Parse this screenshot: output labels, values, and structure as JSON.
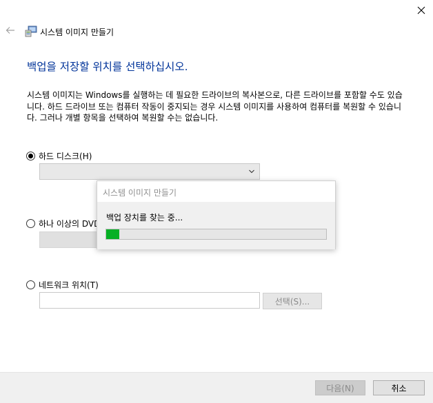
{
  "window": {
    "title": "시스템 이미지 만들기",
    "close_icon": "close-icon",
    "back_icon": "back-arrow-icon",
    "app_icon": "system-image-icon"
  },
  "main": {
    "instruction": "백업을 저장할 위치를 선택하십시오.",
    "description": "시스템 이미지는 Windows를 실행하는 데 필요한 드라이브의 복사본으로, 다른 드라이브를 포함할 수도 있습니다. 하드 드라이브 또는 컴퓨터 작동이 중지되는 경우 시스템 이미지를 사용하여 컴퓨터를 복원할 수 있습니다. 그러나 개별 항목을 선택하여 복원할 수는 없습니다."
  },
  "options": {
    "hard_disk": {
      "label": "하드 디스크(H)",
      "selected": true,
      "value": ""
    },
    "dvd": {
      "label": "하나 이상의 DVD",
      "selected": false,
      "value": ""
    },
    "network": {
      "label": "네트워크 위치(T)",
      "selected": false,
      "value": "",
      "select_button": "선택(S)..."
    }
  },
  "popup": {
    "title": "시스템 이미지 만들기",
    "message": "백업 장치를 찾는 중...",
    "progress": 0.06,
    "progress_color": "#06b025"
  },
  "footer": {
    "next_label": "다음(N)",
    "cancel_label": "취소"
  },
  "colors": {
    "instruction": "#003399",
    "footer_bg": "#f0f0f0"
  }
}
